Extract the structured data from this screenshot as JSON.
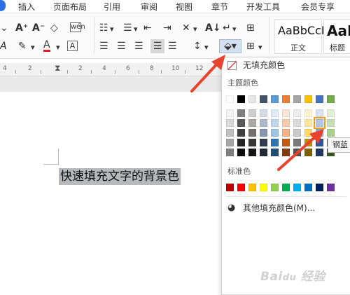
{
  "menu": {
    "items": [
      "插入",
      "页面布局",
      "引用",
      "审阅",
      "视图",
      "章节",
      "开发工具",
      "会员专享"
    ]
  },
  "toolbar": {
    "style_normal_sample": "AaBbCcI",
    "style_normal_label": "正文",
    "style_heading_sample": "AaB",
    "style_heading_label": "标题"
  },
  "ruler": {
    "numbers": [
      "4",
      "2",
      "2",
      "4",
      "6",
      "8",
      "10",
      "12",
      "14",
      "16",
      "18",
      "20"
    ]
  },
  "document": {
    "selected_text": "快速填充文字的背景色"
  },
  "shading_menu": {
    "no_fill_label": "无填充颜色",
    "theme_colors_label": "主题颜色",
    "standard_colors_label": "标准色",
    "more_colors_label": "其他填充颜色(M)...",
    "tooltip": "钢蓝",
    "theme_top_row": [
      "#ffffff",
      "#000000",
      "#e7e6e6",
      "#44546a",
      "#5b9bd5",
      "#ed7d31",
      "#a5a5a5",
      "#ffc000",
      "#4472c4",
      "#70ad47"
    ],
    "theme_columns": [
      [
        "#f2f2f2",
        "#d9d9d9",
        "#bfbfbf",
        "#a6a6a6",
        "#7f7f7f"
      ],
      [
        "#808080",
        "#595959",
        "#404040",
        "#262626",
        "#0d0d0d"
      ],
      [
        "#d0cece",
        "#aeaaaa",
        "#757171",
        "#3b3838",
        "#171616"
      ],
      [
        "#d6dce5",
        "#adb9ca",
        "#8497b0",
        "#333f50",
        "#222a35"
      ],
      [
        "#deebf7",
        "#bdd7ee",
        "#9dc3e6",
        "#2e75b6",
        "#1f4e79"
      ],
      [
        "#fbe5d6",
        "#f8cbad",
        "#f4b183",
        "#c55a11",
        "#843c0c"
      ],
      [
        "#ededed",
        "#dbdbdb",
        "#c9c9c9",
        "#7b7b7b",
        "#525252"
      ],
      [
        "#fff2cc",
        "#ffe699",
        "#ffd966",
        "#bf9000",
        "#7f6000"
      ],
      [
        "#dae3f3",
        "#b4c7e7",
        "#8faadc",
        "#2f5597",
        "#203864"
      ],
      [
        "#e2f0d9",
        "#c5e0b4",
        "#a9d18e",
        "#548235",
        "#385723"
      ]
    ],
    "selected_swatch_color": "#b4c7e7",
    "standard_colors": [
      "#c00000",
      "#ff0000",
      "#ffc000",
      "#ffff00",
      "#92d050",
      "#00b050",
      "#00b0f0",
      "#0070c0",
      "#002060",
      "#7030a0"
    ]
  },
  "colors": {
    "accent": "#2f6fe4",
    "selection": "#b7b9bc",
    "arrow": "#e8432e"
  }
}
